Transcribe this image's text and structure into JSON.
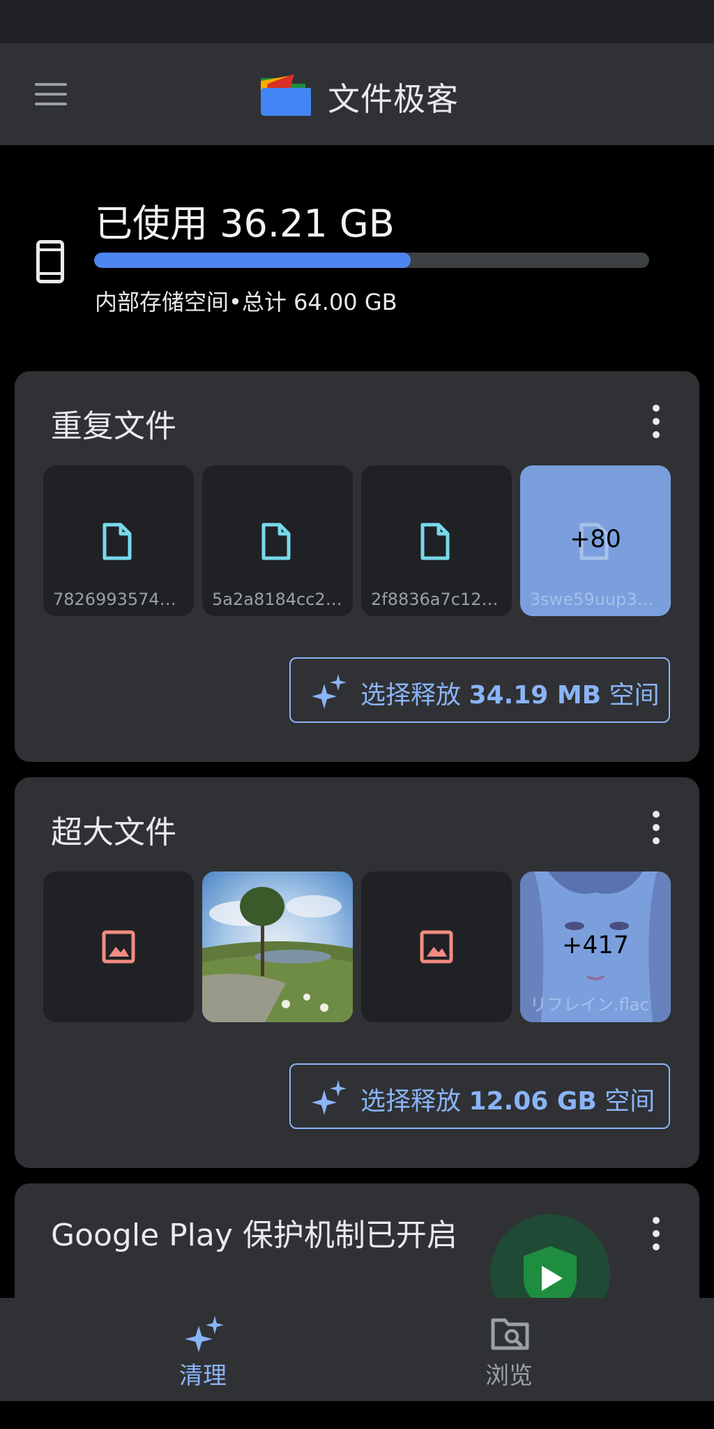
{
  "app": {
    "title": "文件极客"
  },
  "storage": {
    "used_label": "已使用 36.21 GB",
    "used_fraction": 0.57,
    "total_label": "内部存储空间•总计 64.00 GB"
  },
  "duplicates": {
    "title": "重复文件",
    "files": [
      {
        "name": "78269935740..."
      },
      {
        "name": "5a2a8184cc20..."
      },
      {
        "name": "2f8836a7c122..."
      }
    ],
    "more_count": "+80",
    "more_name": "3swe59uup3u...",
    "action_prefix": "选择释放 ",
    "action_size": "34.19 MB",
    "action_suffix": " 空间"
  },
  "large_files": {
    "title": "超大文件",
    "more_count": "+417",
    "more_name": "リフレイン.flac",
    "action_prefix": "选择释放 ",
    "action_size": "12.06 GB",
    "action_suffix": " 空间"
  },
  "play_protect": {
    "title": "Google Play 保护机制已开启"
  },
  "nav": {
    "clean_label": "清理",
    "browse_label": "浏览"
  },
  "colors": {
    "accent": "#8ab4f8",
    "progress": "#4e86f1",
    "file_icon": "#78d9ec",
    "image_icon": "#f28b82",
    "card_bg": "#303134"
  },
  "icons": [
    "menu-icon",
    "files-logo",
    "phone-icon",
    "more-vert-icon",
    "document-icon",
    "image-icon",
    "sparkle-icon",
    "shield-play-icon",
    "browse-icon"
  ]
}
